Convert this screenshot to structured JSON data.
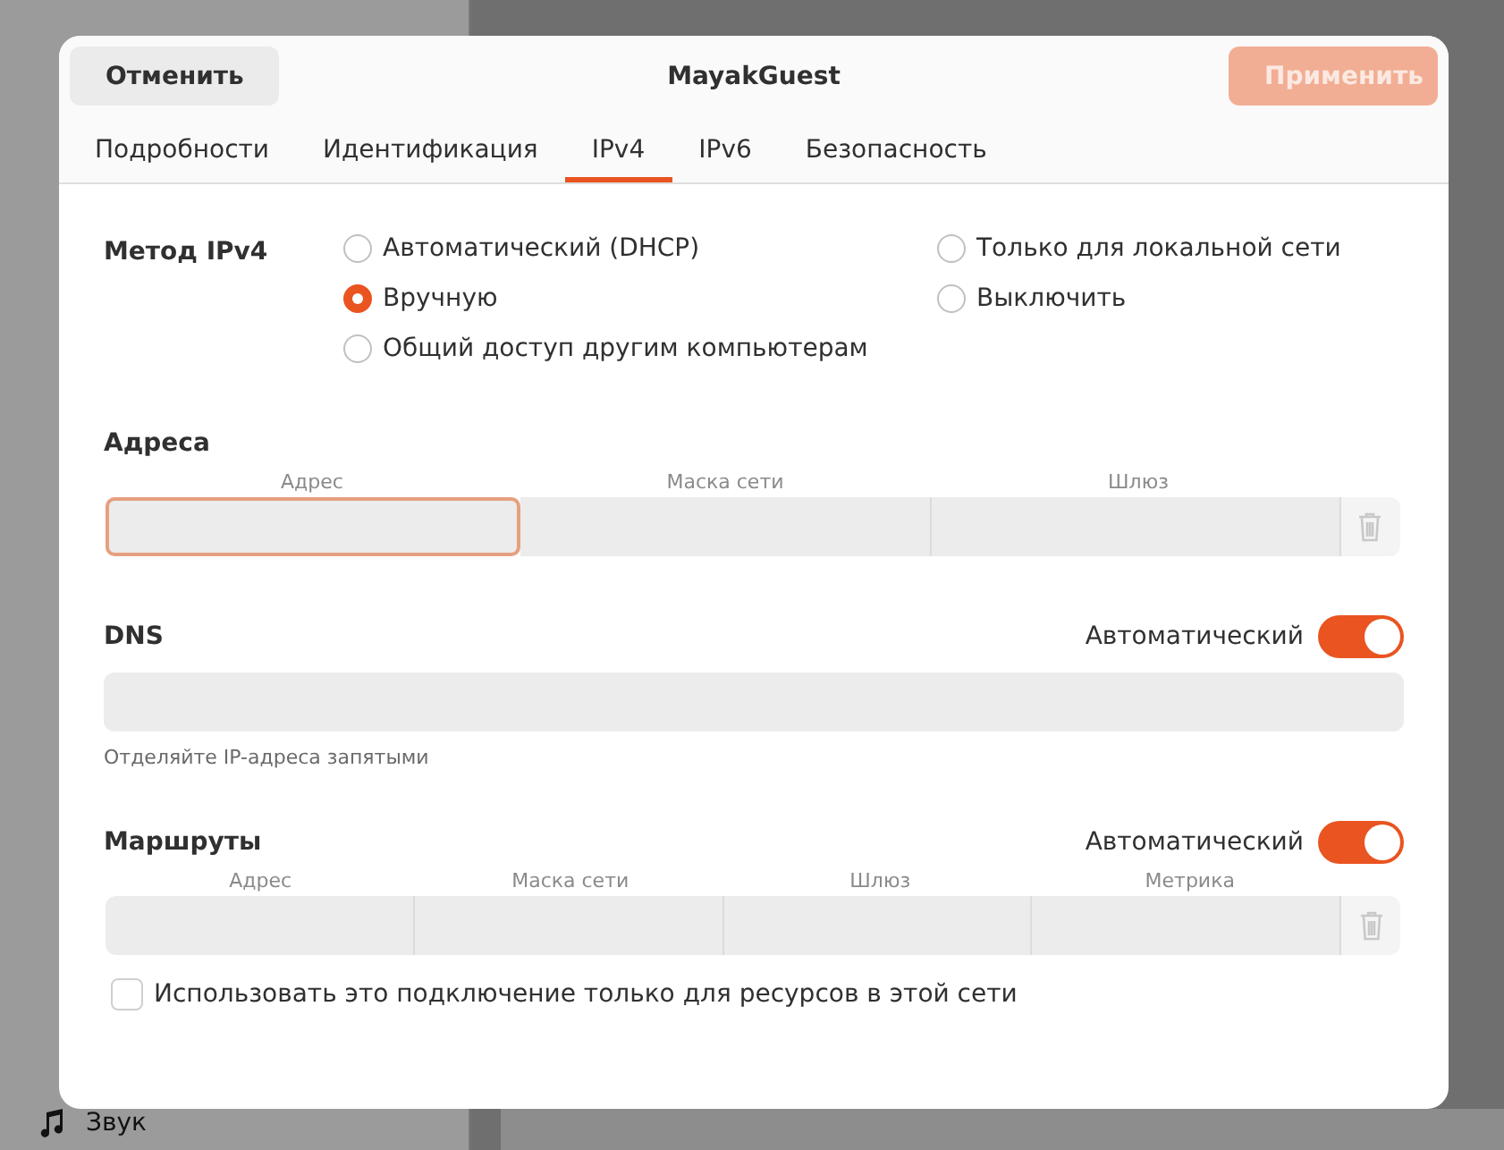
{
  "background": {
    "sidebar_items": [
      {
        "label": "Звук"
      }
    ]
  },
  "dialog": {
    "title": "MayakGuest",
    "cancel": "Отменить",
    "apply": {
      "label": "Применить",
      "disabled": true
    }
  },
  "tabs": [
    {
      "label": "Подробности",
      "selected": false
    },
    {
      "label": "Идентификация",
      "selected": false
    },
    {
      "label": "IPv4",
      "selected": true
    },
    {
      "label": "IPv6",
      "selected": false
    },
    {
      "label": "Безопасность",
      "selected": false
    }
  ],
  "method": {
    "label": "Метод IPv4",
    "options": [
      {
        "label": "Автоматический (DHCP)",
        "selected": false
      },
      {
        "label": "Только для локальной сети",
        "selected": false
      },
      {
        "label": "Вручную",
        "selected": true
      },
      {
        "label": "Выключить",
        "selected": false
      },
      {
        "label": "Общий доступ другим компьютерам",
        "selected": false
      }
    ]
  },
  "addresses": {
    "title": "Адреса",
    "columns": [
      {
        "label": "Адрес",
        "focused": true
      },
      {
        "label": "Маска сети",
        "focused": false
      },
      {
        "label": "Шлюз",
        "focused": false
      }
    ]
  },
  "dns": {
    "title": "DNS",
    "auto_label": "Автоматический",
    "auto": true,
    "hint": "Отделяйте IP-адреса запятыми"
  },
  "routes": {
    "title": "Маршруты",
    "auto_label": "Автоматический",
    "auto": true,
    "columns": [
      {
        "label": "Адрес",
        "focused": false
      },
      {
        "label": "Маска сети",
        "focused": false
      },
      {
        "label": "Шлюз",
        "focused": false
      },
      {
        "label": "Метрика",
        "focused": false
      }
    ]
  },
  "only_local_resources": {
    "label": "Использовать это подключение только для ресурсов в этой сети",
    "checked": false
  }
}
